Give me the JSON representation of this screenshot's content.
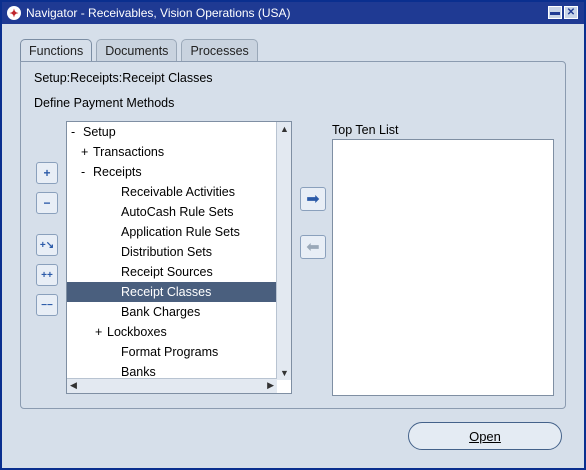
{
  "window": {
    "title": "Navigator - Receivables, Vision Operations (USA)",
    "minimize_label": "▬",
    "close_label": "✕"
  },
  "tabs": [
    {
      "label": "Functions",
      "active": true
    },
    {
      "label": "Documents",
      "active": false
    },
    {
      "label": "Processes",
      "active": false
    }
  ],
  "path_text": "Setup:Receipts:Receipt Classes",
  "description": "Define Payment Methods",
  "side_buttons": {
    "expand_one": "+",
    "collapse_one": "−",
    "expand_branch": "+↘",
    "expand_all": "++",
    "collapse_all": "−−"
  },
  "tree": {
    "rows": [
      {
        "prefix": "-",
        "label": "Setup"
      },
      {
        "prefix": "+",
        "label": "Transactions"
      },
      {
        "prefix": "-",
        "label": "Receipts"
      },
      {
        "prefix": "",
        "label": "Receivable Activities"
      },
      {
        "prefix": "",
        "label": "AutoCash Rule Sets"
      },
      {
        "prefix": "",
        "label": "Application Rule Sets"
      },
      {
        "prefix": "",
        "label": "Distribution Sets"
      },
      {
        "prefix": "",
        "label": "Receipt Sources"
      },
      {
        "prefix": "",
        "label": "Receipt Classes"
      },
      {
        "prefix": "",
        "label": "Bank Charges"
      },
      {
        "prefix": "+",
        "label": "Lockboxes"
      },
      {
        "prefix": "",
        "label": "Format Programs"
      },
      {
        "prefix": "",
        "label": "Banks"
      }
    ],
    "selected": "Receipt Classes"
  },
  "move_buttons": {
    "add": "➡",
    "remove": "⬅"
  },
  "topten": {
    "label": "Top Ten List"
  },
  "open_button": {
    "label": "Open"
  },
  "colors": {
    "titlebar": "#1f3a93",
    "selected_row": "#4a5f7e",
    "background": "#d6dfea"
  }
}
